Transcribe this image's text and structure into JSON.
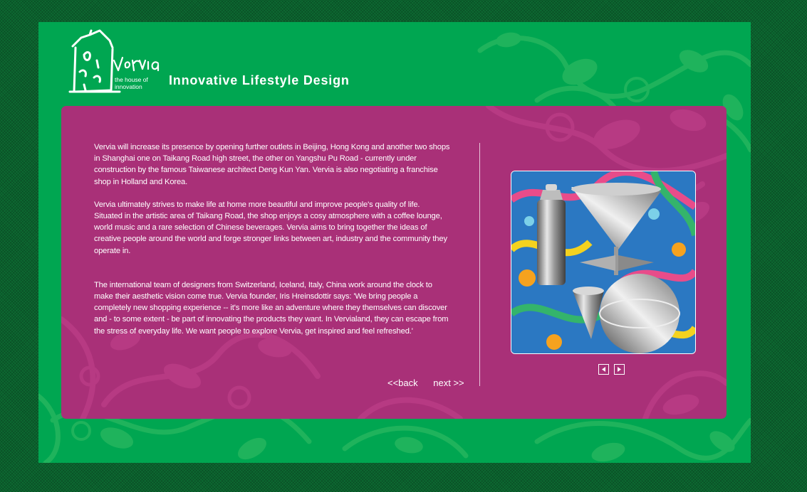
{
  "brand": {
    "logo_text": "Vervia",
    "logo_subtitle_1": "the house of",
    "logo_subtitle_2": "innovation",
    "tagline": "Innovative Lifestyle Design"
  },
  "content": {
    "paragraphs": [
      "Vervia will increase its presence by opening further outlets in Beijing, Hong Kong and another two shops in Shanghai one on Taikang Road high street, the other on Yangshu Pu Road - currently under construction by the famous Taiwanese architect Deng Kun Yan. Vervia is also negotiating a franchise shop in Holland and Korea.",
      "Vervia ultimately strives to make life at home more beautiful and improve people's quality of life. Situated in the artistic area of Taikang Road, the shop enjoys a cosy atmosphere with a coffee lounge, world music and a rare selection of Chinese beverages. Vervia aims to bring together the ideas of creative people around the world and forge stronger links between art, industry and the community they operate in.",
      "The international team of designers from Switzerland, Iceland, Italy, China work around the clock to make their aesthetic vision come true. Vervia founder, Iris Hreinsdottir says: 'We bring people a completely new shopping experience -- it's more like an adventure where they themselves can discover and - to some extent - be part of innovating the products they want. In Vervialand, they can escape from the stress of everyday life. We want people to explore Vervia, get inspired and feel refreshed.'"
    ],
    "nav": {
      "back": "<<back",
      "next": "next >>"
    }
  },
  "gallery": {
    "prev_icon": "triangle-left-icon",
    "next_icon": "triangle-right-icon"
  },
  "colors": {
    "background_green": "#00a651",
    "panel_magenta": "#a93078",
    "outer_dark_green": "#0d6a32"
  }
}
